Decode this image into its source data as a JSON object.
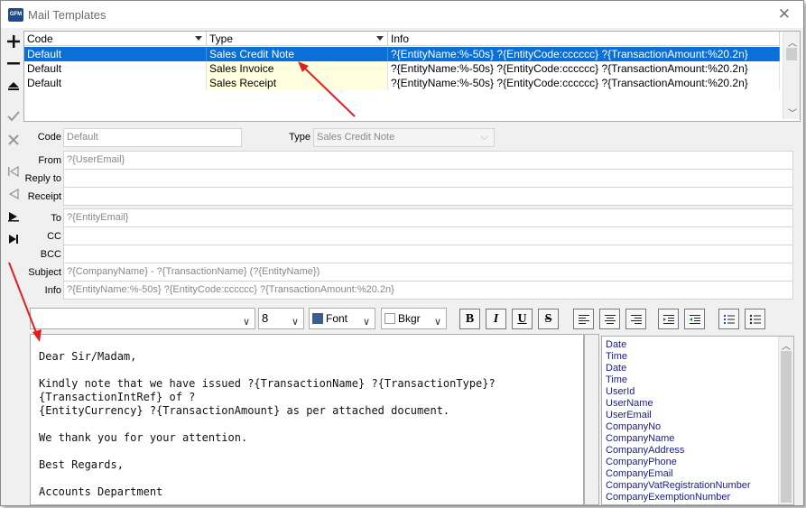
{
  "window": {
    "title": "Mail Templates",
    "app_icon": "GFM"
  },
  "toolbar": {
    "add": "add-icon",
    "remove": "minus-icon",
    "up": "move-up-icon",
    "ok": "check-icon",
    "cancel": "cancel-icon",
    "first": "first-record-icon",
    "prev": "prev-record-icon",
    "next": "next-record-icon",
    "last": "last-record-icon"
  },
  "grid": {
    "headers": [
      "Code",
      "Type",
      "Info"
    ],
    "rows": [
      {
        "code": "Default",
        "type": "Sales Credit Note",
        "info": "?{EntityName:%-50s} ?{EntityCode:cccccc} ?{TransactionAmount:%20.2n}"
      },
      {
        "code": "Default",
        "type": "Sales Invoice",
        "info": "?{EntityName:%-50s} ?{EntityCode:cccccc} ?{TransactionAmount:%20.2n}"
      },
      {
        "code": "Default",
        "type": "Sales Receipt",
        "info": "?{EntityName:%-50s} ?{EntityCode:cccccc} ?{TransactionAmount:%20.2n}"
      }
    ]
  },
  "form": {
    "code_label": "Code",
    "code_value": "Default",
    "type_label": "Type",
    "type_value": "Sales Credit Note",
    "from_label": "From",
    "from_value": "?{UserEmail}",
    "replyto_label": "Reply to",
    "replyto_value": "",
    "receipt_label": "Receipt",
    "receipt_value": "",
    "to_label": "To",
    "to_value": "?{EntityEmail}",
    "cc_label": "CC",
    "cc_value": "",
    "bcc_label": "BCC",
    "bcc_value": "",
    "subject_label": "Subject",
    "subject_value": "?{CompanyName} - ?{TransactionName} (?{EntityName})",
    "info_label": "Info",
    "info_value": "?{EntityName:%-50s} ?{EntityCode:cccccc} ?{TransactionAmount:%20.2n}"
  },
  "format_bar": {
    "font_name": "",
    "font_size": "8",
    "font_color_label": "Font",
    "bkgr_label": "Bkgr",
    "bold": "B",
    "italic": "I",
    "underline": "U",
    "strike": "S"
  },
  "editor": {
    "lines": [
      "Dear Sir/Madam,",
      "Kindly note that we have issued ?{TransactionName} ?{TransactionType}?{TransactionIntRef} of ?",
      "{EntityCurrency} ?{TransactionAmount} as per attached document.",
      "We thank you for your attention.",
      "Best Regards,",
      "Accounts Department"
    ]
  },
  "variables": [
    "Date",
    "Time",
    "Date",
    "Time",
    "UserId",
    "UserName",
    "UserEmail",
    "CompanyNo",
    "CompanyName",
    "CompanyAddress",
    "CompanyPhone",
    "CompanyEmail",
    "CompanyVatRegistrationNumber",
    "CompanyExemptionNumber"
  ],
  "colors": {
    "selection": "#0a6fd6",
    "highlight": "#ffffe0",
    "arrow": "#e02020"
  }
}
